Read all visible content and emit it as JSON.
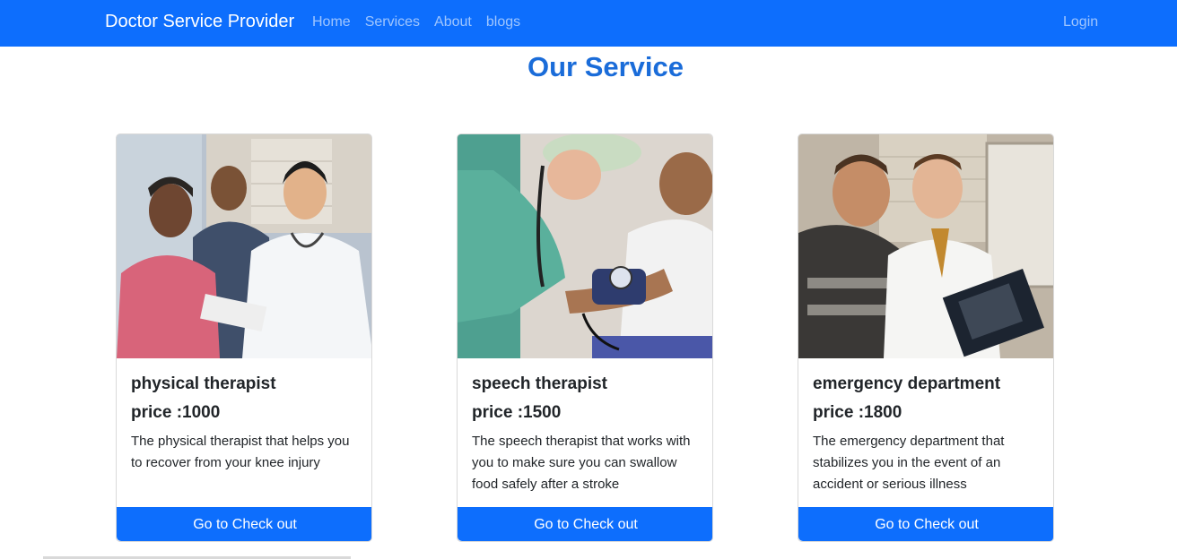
{
  "navbar": {
    "brand": "Doctor Service Provider",
    "links": [
      "Home",
      "Services",
      "About",
      "blogs"
    ],
    "login": "Login",
    "bg_color": "#0d6efd"
  },
  "page": {
    "title": "Our Service"
  },
  "services": [
    {
      "title": "physical therapist",
      "price": "price :1000",
      "description": "The physical therapist that helps you to recover from your knee injury",
      "button": "Go to Check out",
      "image_icon": "doctor-patients-photo"
    },
    {
      "title": "speech therapist",
      "price": "price :1500",
      "description": "The speech therapist that works with you to make sure you can swallow food safely after a stroke",
      "button": "Go to Check out",
      "image_icon": "blood-pressure-photo"
    },
    {
      "title": "emergency department",
      "price": "price :1800",
      "description": "The emergency department that stabilizes you in the event of an accident or serious illness",
      "button": "Go to Check out",
      "image_icon": "xray-review-photo"
    }
  ]
}
